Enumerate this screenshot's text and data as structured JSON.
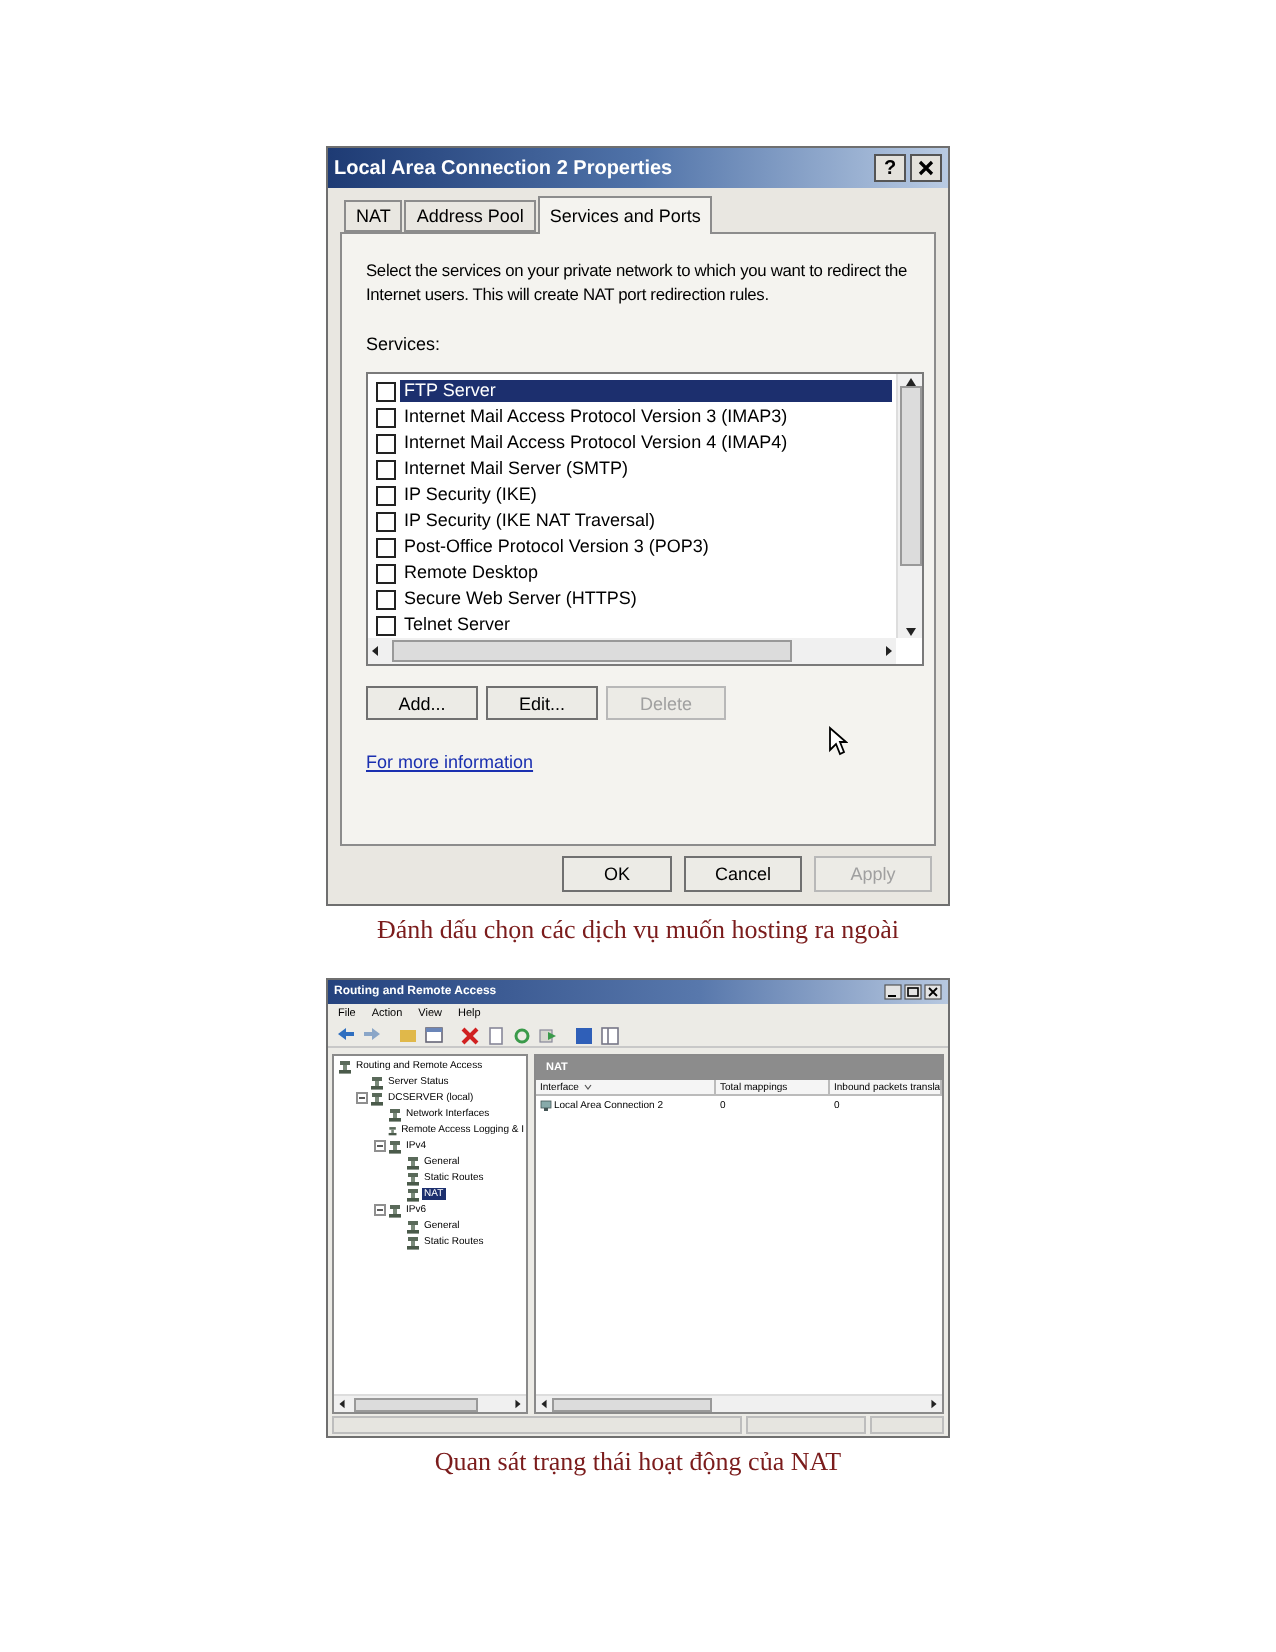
{
  "dialog": {
    "title": "Local Area Connection 2 Properties",
    "help": "?",
    "tabs": [
      {
        "label": "NAT",
        "selected": false
      },
      {
        "label": "Address Pool",
        "selected": false
      },
      {
        "label": "Services and Ports",
        "selected": true
      }
    ],
    "description": "Select the services on your private network to which you want to redirect the Internet users. This will create NAT port redirection rules.",
    "services_label": "Services:",
    "services": [
      {
        "name": "FTP Server",
        "checked": false,
        "selected": true
      },
      {
        "name": "Internet Mail Access Protocol Version 3 (IMAP3)",
        "checked": false,
        "selected": false
      },
      {
        "name": "Internet Mail Access Protocol Version 4 (IMAP4)",
        "checked": false,
        "selected": false
      },
      {
        "name": "Internet Mail Server (SMTP)",
        "checked": false,
        "selected": false
      },
      {
        "name": "IP Security (IKE)",
        "checked": false,
        "selected": false
      },
      {
        "name": "IP Security (IKE NAT Traversal)",
        "checked": false,
        "selected": false
      },
      {
        "name": "Post-Office Protocol Version 3 (POP3)",
        "checked": false,
        "selected": false
      },
      {
        "name": "Remote Desktop",
        "checked": false,
        "selected": false
      },
      {
        "name": "Secure Web Server (HTTPS)",
        "checked": false,
        "selected": false
      },
      {
        "name": "Telnet Server",
        "checked": false,
        "selected": false
      }
    ],
    "buttons": [
      {
        "label": "Add...",
        "disabled": false
      },
      {
        "label": "Edit...",
        "disabled": false
      },
      {
        "label": "Delete",
        "disabled": true
      }
    ],
    "link": "For more information",
    "footer_buttons": [
      {
        "label": "OK",
        "disabled": false
      },
      {
        "label": "Cancel",
        "disabled": false
      },
      {
        "label": "Apply",
        "disabled": true
      }
    ]
  },
  "caption_1": "Đánh dấu chọn các dịch vụ muốn hosting ra ngoài",
  "rras": {
    "title": "Routing and Remote Access",
    "menu": [
      "File",
      "Action",
      "View",
      "Help"
    ],
    "tree": [
      {
        "label": "Routing and Remote Access",
        "selected": false,
        "children": [
          {
            "label": "Server Status",
            "selected": false
          },
          {
            "label": "DCSERVER (local)",
            "selected": false,
            "expanded": true,
            "children": [
              {
                "label": "Network Interfaces",
                "selected": false
              },
              {
                "label": "Remote Access Logging & I",
                "selected": false
              },
              {
                "label": "IPv4",
                "selected": false,
                "expanded": true,
                "children": [
                  {
                    "label": "General",
                    "selected": false
                  },
                  {
                    "label": "Static Routes",
                    "selected": false
                  },
                  {
                    "label": "NAT",
                    "selected": true
                  }
                ]
              },
              {
                "label": "IPv6",
                "selected": false,
                "expanded": true,
                "children": [
                  {
                    "label": "General",
                    "selected": false
                  },
                  {
                    "label": "Static Routes",
                    "selected": false
                  }
                ]
              }
            ]
          }
        ]
      }
    ],
    "pane_title": "NAT",
    "columns": [
      "Interface",
      "Total mappings",
      "Inbound packets transla"
    ],
    "rows": [
      {
        "cells": [
          "Local Area Connection 2",
          "0",
          "0"
        ]
      }
    ]
  },
  "caption_2": "Quan sát trạng thái hoạt động của NAT"
}
